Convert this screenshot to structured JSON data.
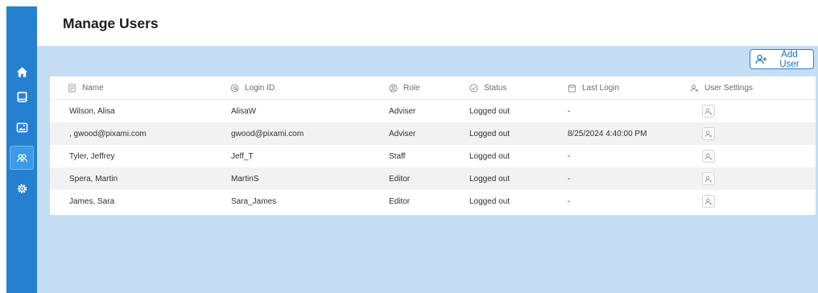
{
  "page": {
    "title": "Manage Users"
  },
  "sidebar": {
    "items": [
      {
        "icon": "home-icon"
      },
      {
        "icon": "book-icon"
      },
      {
        "icon": "gallery-icon"
      },
      {
        "icon": "users-icon",
        "active": true
      },
      {
        "icon": "gear-icon"
      }
    ]
  },
  "toolbar": {
    "add_user_label": "Add User"
  },
  "table": {
    "headers": {
      "name": "Name",
      "login_id": "Login ID",
      "role": "Role",
      "status": "Status",
      "last_login": "Last Login",
      "user_settings": "User Settings"
    },
    "rows": [
      {
        "name": "Wilson, Alisa",
        "login_id": "AlisaW",
        "role": "Adviser",
        "status": "Logged out",
        "last_login": "-"
      },
      {
        "name": ", gwood@pixami.com",
        "login_id": "gwood@pixami.com",
        "role": "Adviser",
        "status": "Logged out",
        "last_login": "8/25/2024 4:40:00 PM"
      },
      {
        "name": "Tyler, Jeffrey",
        "login_id": "Jeff_T",
        "role": "Staff",
        "status": "Logged out",
        "last_login": "-"
      },
      {
        "name": "Spera, Martin",
        "login_id": "MartinS",
        "role": "Editor",
        "status": "Logged out",
        "last_login": "-"
      },
      {
        "name": "James, Sara",
        "login_id": "Sara_James",
        "role": "Editor",
        "status": "Logged out",
        "last_login": "-"
      }
    ]
  },
  "colors": {
    "sidebar": "#2580cf",
    "content_bg": "#c5def3",
    "accent": "#1f6fc2"
  }
}
